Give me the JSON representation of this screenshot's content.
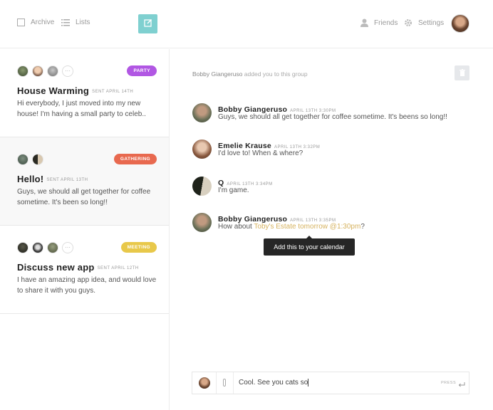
{
  "topbar": {
    "archive_label": "Archive",
    "lists_label": "Lists",
    "friends_label": "Friends",
    "settings_label": "Settings"
  },
  "groups": [
    {
      "title": "House Warming",
      "sent": "SENT APRIL 14TH",
      "badge": "PARTY",
      "badge_color": "#b157e3",
      "body": "Hi everybody, I just moved into my new house! I'm having a small party to celeb..",
      "member_avatars": 3,
      "has_more": true
    },
    {
      "title": "Hello!",
      "sent": "SENT APRIL 13TH",
      "badge": "GATHERING",
      "badge_color": "#e8694f",
      "body": "Guys, we should all get together for coffee sometime. It's been so long!!",
      "member_avatars": 2,
      "has_more": false
    },
    {
      "title": "Discuss new app",
      "sent": "SENT APRIL 12TH",
      "badge": "MEETING",
      "badge_color": "#e8c84a",
      "body": "I have an amazing app idea, and would love to share it with you guys.",
      "member_avatars": 3,
      "has_more": true
    }
  ],
  "conversation": {
    "system_note_name": "Bobby Giangeruso",
    "system_note_text": " added you to this group",
    "messages": [
      {
        "name": "Bobby Giangeruso",
        "time": "APRIL 13TH 3:30PM",
        "text": "Guys, we should all get together for coffee sometime. It's beens so long!!"
      },
      {
        "name": "Emelie Krause",
        "time": "APRIL 13TH 3:32PM",
        "text": "I'd love to! When & where?"
      },
      {
        "name": "Q",
        "time": "APRIL 13TH 3:34PM",
        "text": "I'm game."
      },
      {
        "name": "Bobby Giangeruso",
        "time": "APRIL 13TH 3:35PM",
        "text_before": "How about ",
        "text_highlight": "Toby's Estate tomorrow @1:30pm",
        "text_after": "?"
      }
    ],
    "tooltip": "Add this to your calendar"
  },
  "composer": {
    "input_value": "Cool. See you cats so",
    "press_label": "PRESS"
  },
  "colors": {
    "accent": "#7fd0d0",
    "highlight": "#d6b25e"
  }
}
